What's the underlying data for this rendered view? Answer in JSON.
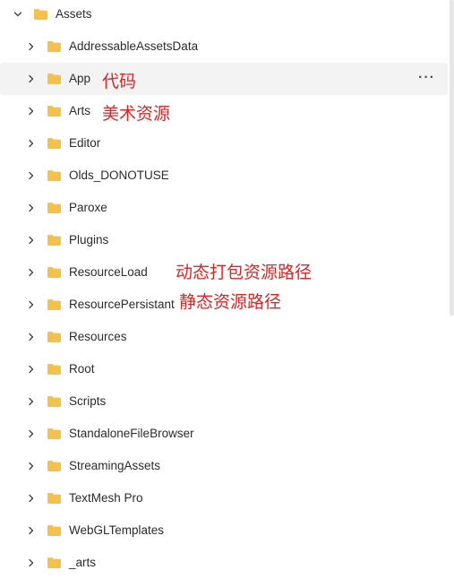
{
  "tree": {
    "root": {
      "label": "Assets"
    },
    "children": [
      {
        "label": "AddressableAssetsData"
      },
      {
        "label": "App"
      },
      {
        "label": "Arts"
      },
      {
        "label": "Editor"
      },
      {
        "label": "Olds_DONOTUSE"
      },
      {
        "label": "Paroxe"
      },
      {
        "label": "Plugins"
      },
      {
        "label": "ResourceLoad"
      },
      {
        "label": "ResourcePersistant"
      },
      {
        "label": "Resources"
      },
      {
        "label": "Root"
      },
      {
        "label": "Scripts"
      },
      {
        "label": "StandaloneFileBrowser"
      },
      {
        "label": "StreamingAssets"
      },
      {
        "label": "TextMesh Pro"
      },
      {
        "label": "WebGLTemplates"
      },
      {
        "label": "_arts"
      }
    ],
    "hovered_index": 1,
    "more_label": "···"
  },
  "annotations": {
    "app": "代码",
    "arts": "美术资源",
    "resource_load": "动态打包资源路径",
    "resource_persistant": "静态资源路径"
  },
  "colors": {
    "folder": "#f2c14e",
    "annotation": "#e02424",
    "hover": "#f3f3f3"
  },
  "icons": {
    "expand": "chevron-down-icon",
    "collapse": "chevron-right-icon",
    "folder": "folder-icon",
    "more": "more-horizontal-icon"
  }
}
